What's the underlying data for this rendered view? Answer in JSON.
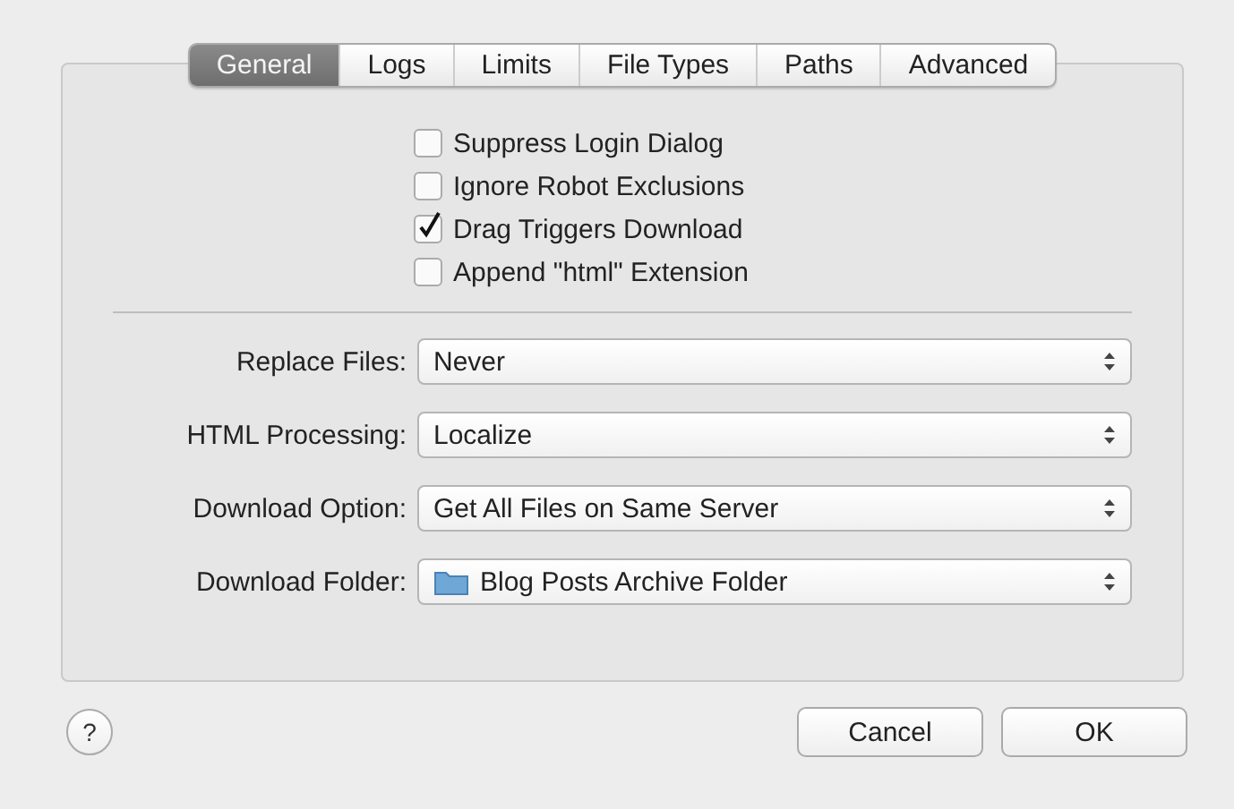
{
  "tabs": [
    {
      "label": "General",
      "selected": true
    },
    {
      "label": "Logs",
      "selected": false
    },
    {
      "label": "Limits",
      "selected": false
    },
    {
      "label": "File Types",
      "selected": false
    },
    {
      "label": "Paths",
      "selected": false
    },
    {
      "label": "Advanced",
      "selected": false
    }
  ],
  "options": [
    {
      "label": "Suppress Login Dialog",
      "checked": false
    },
    {
      "label": "Ignore Robot Exclusions",
      "checked": false
    },
    {
      "label": "Drag Triggers Download",
      "checked": true
    },
    {
      "label": "Append \"html\" Extension",
      "checked": false
    }
  ],
  "fields": [
    {
      "label": "Replace Files:",
      "value": "Never",
      "kind": "plain"
    },
    {
      "label": "HTML Processing:",
      "value": "Localize",
      "kind": "plain"
    },
    {
      "label": "Download Option:",
      "value": "Get All Files on Same Server",
      "kind": "plain"
    },
    {
      "label": "Download Folder:",
      "value": "Blog Posts Archive Folder",
      "kind": "folder"
    }
  ],
  "help": {
    "label": "?"
  },
  "buttons": [
    {
      "label": "Cancel"
    },
    {
      "label": "OK"
    }
  ]
}
